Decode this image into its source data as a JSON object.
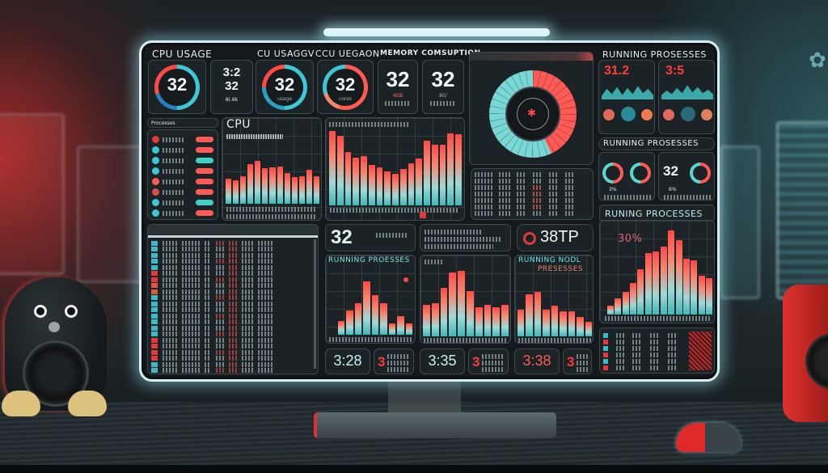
{
  "scene": {
    "description": "Monitor on desk displaying a system monitoring dashboard",
    "accent_red": "#ff4a44",
    "accent_teal": "#3fd0d0"
  },
  "headers": {
    "cpu_usage": "CPU USAGE",
    "cpu_usage_2": "CU USAGGV",
    "cpu_utilization": "CCU UEGAON",
    "memory_consumption": "MEMORY COMSUPTION",
    "running_processes_top": "RUNNING PROSESSES",
    "running_processes_mid": "RUNNING PROSESSES",
    "running_processes_right": "RUNING PROCESSES",
    "cpu_chart": "CPU",
    "running_processes_chart": "RUNNING PROESSES",
    "running_node_processes": "RUNNING NODL",
    "running_node_processes_2": "PRESESSES"
  },
  "top_stats": {
    "gauge1_value": "32",
    "stack_value_a": "3:2",
    "stack_value_b": "32",
    "stack_sub": "8(.6k",
    "gauge2_value": "32",
    "gauge2_sub": "usage",
    "gauge3_value": "32",
    "gauge3_sub": "cores",
    "mem_value_1": "32",
    "mem_sub_1": "4GB",
    "mem_value_2": "32",
    "mem_sub_2": "80/"
  },
  "running_processes": {
    "timer_1": "31.2",
    "timer_1_suffix": "%",
    "timer_2": "3:5",
    "timer_2_suffix": "%",
    "mini_gauge_value": "32",
    "mini_pct_1": "3%",
    "mini_pct_2": "%",
    "mini_pct_3": "6%"
  },
  "middle": {
    "stat_value": "32",
    "status_value": "38TP",
    "pct_label": "30%"
  },
  "bottom_stats": [
    {
      "value": "3:28",
      "side": "3"
    },
    {
      "value": "3:35",
      "side": "3"
    },
    {
      "value": "3:38",
      "side": "3"
    }
  ],
  "side_list": {
    "header": "Processes",
    "items": [
      {
        "color": "#e03a3a",
        "pill": "#ff5a55"
      },
      {
        "color": "#3fc7d6",
        "pill": "#ff5a55"
      },
      {
        "color": "#3fc7d6",
        "pill": "#3fd0c8"
      },
      {
        "color": "#3fc7d6",
        "pill": "#ff5a55"
      },
      {
        "color": "#ff5a55",
        "pill": "#ff5a55"
      },
      {
        "color": "#e04a4a",
        "pill": "#ff5a55"
      },
      {
        "color": "#3fc7d6",
        "pill": "#3fd0c8"
      },
      {
        "color": "#3fc7d6",
        "pill": "#ff5a55"
      },
      {
        "color": "#a04a55",
        "pill": "#3fd0c8"
      }
    ]
  },
  "chart_data": [
    {
      "type": "bar",
      "title": "CPU",
      "values": [
        40,
        37,
        44,
        63,
        68,
        57,
        58,
        59,
        49,
        42,
        44,
        54,
        44
      ],
      "ylim": [
        0,
        100
      ]
    },
    {
      "type": "bar",
      "title": "Memory",
      "values": [
        98,
        92,
        70,
        63,
        65,
        53,
        50,
        45,
        42,
        48,
        55,
        62,
        85,
        80,
        80,
        95,
        94
      ],
      "ylim": [
        0,
        100
      ]
    },
    {
      "type": "bar",
      "title": "Running Processes",
      "values": [
        22,
        38,
        50,
        85,
        63,
        50,
        18,
        30,
        18
      ],
      "ylim": [
        0,
        100
      ]
    },
    {
      "type": "bar",
      "title": "Running",
      "values": [
        45,
        48,
        70,
        92,
        94,
        65,
        42,
        45,
        42,
        45
      ],
      "ylim": [
        0,
        100
      ]
    },
    {
      "type": "bar",
      "title": "Running Node Processes",
      "values": [
        45,
        70,
        75,
        45,
        52,
        42,
        42,
        33,
        25
      ],
      "ylim": [
        0,
        100
      ]
    },
    {
      "type": "bar",
      "title": "Runing Processes",
      "values": [
        10,
        18,
        25,
        35,
        50,
        68,
        70,
        75,
        93,
        82,
        62,
        60,
        43,
        40
      ],
      "ylim": [
        0,
        100
      ]
    },
    {
      "type": "area",
      "title": "Running Processes sparkline 1",
      "values": [
        20,
        60,
        30,
        70,
        25,
        65,
        30,
        75,
        35,
        60,
        25
      ]
    },
    {
      "type": "area",
      "title": "Running Processes sparkline 2",
      "values": [
        25,
        50,
        30,
        65,
        35,
        80,
        40,
        70,
        35,
        55,
        30
      ]
    }
  ]
}
